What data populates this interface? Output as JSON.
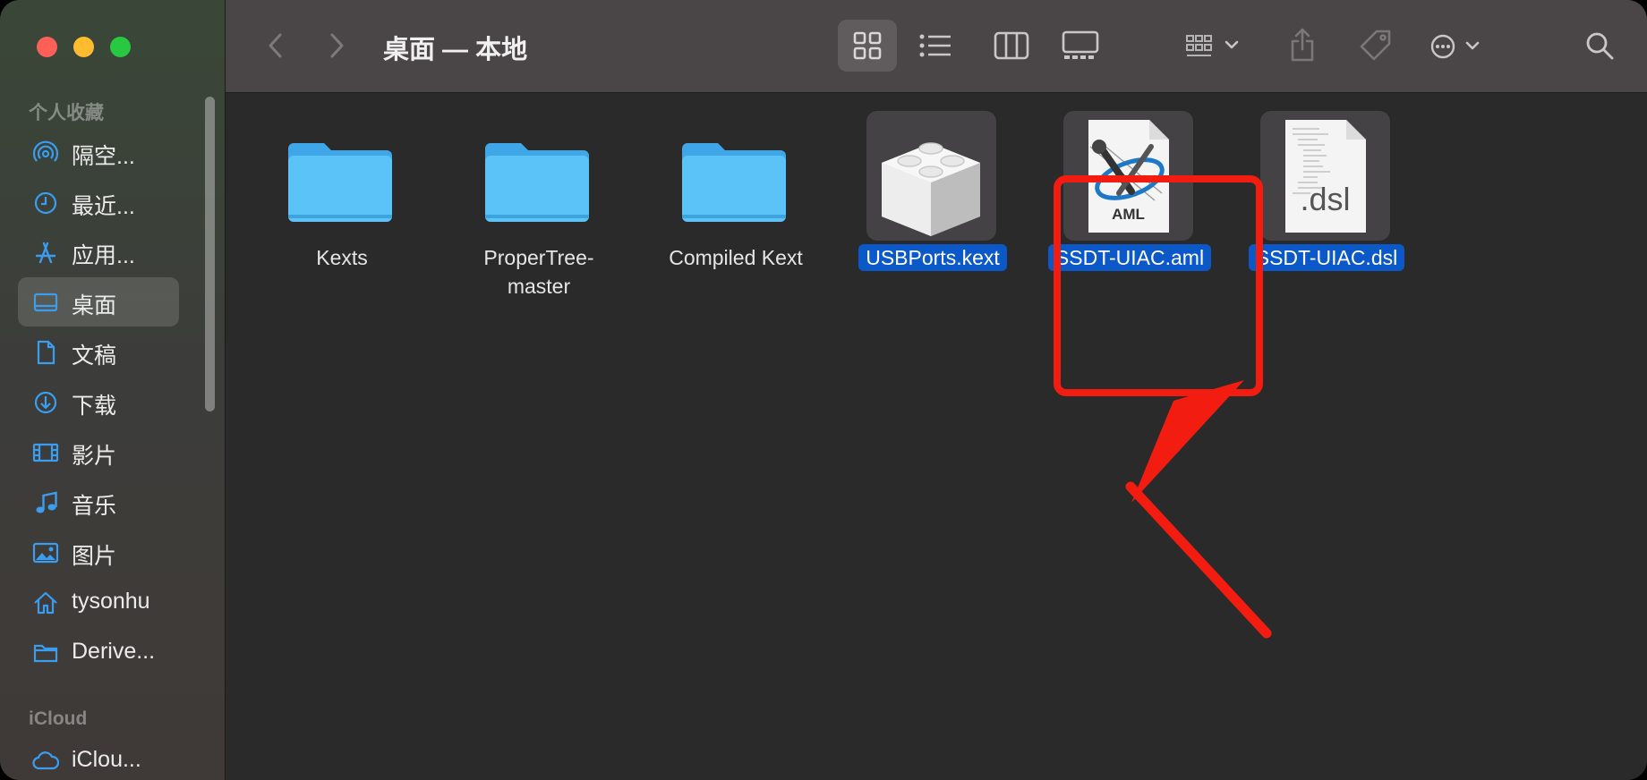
{
  "window": {
    "title": "桌面 — 本地"
  },
  "sidebar": {
    "favorites_title": "个人收藏",
    "items": [
      {
        "label": "隔空...",
        "icon": "airdrop-icon"
      },
      {
        "label": "最近...",
        "icon": "clock-icon"
      },
      {
        "label": "应用...",
        "icon": "applications-icon"
      },
      {
        "label": "桌面",
        "icon": "desktop-icon",
        "active": true
      },
      {
        "label": "文稿",
        "icon": "document-icon"
      },
      {
        "label": "下载",
        "icon": "download-icon"
      },
      {
        "label": "影片",
        "icon": "film-icon"
      },
      {
        "label": "音乐",
        "icon": "music-icon"
      },
      {
        "label": "图片",
        "icon": "photo-icon"
      },
      {
        "label": "tysonhu",
        "icon": "home-icon"
      },
      {
        "label": "Derive...",
        "icon": "folder-icon"
      }
    ],
    "icloud_title": "iCloud",
    "icloud_items": [
      {
        "label": "iClou...",
        "icon": "cloud-icon"
      }
    ]
  },
  "toolbar": {
    "buttons": [
      "back-icon",
      "forward-icon",
      "icon-view-icon",
      "list-view-icon",
      "column-view-icon",
      "gallery-view-icon",
      "group-icon",
      "share-icon",
      "tag-icon",
      "more-icon",
      "search-icon"
    ],
    "selected_view": "icon-view"
  },
  "files": [
    {
      "name": "Kexts",
      "kind": "folder",
      "selected": false
    },
    {
      "name": "ProperTree-master",
      "name_lines": [
        "ProperTree-",
        "master"
      ],
      "kind": "folder",
      "selected": false
    },
    {
      "name": "Compiled Kext",
      "kind": "folder",
      "selected": false
    },
    {
      "name": "USBPorts.kext",
      "kind": "kext",
      "selected": true
    },
    {
      "name": "SSDT-UIAC.aml",
      "kind": "aml",
      "badge": "AML",
      "selected": true
    },
    {
      "name": "SSDT-UIAC.dsl",
      "kind": "dsl",
      "badge": ".dsl",
      "selected": true
    }
  ],
  "colors": {
    "accent_selection": "#0b58c9",
    "folder_blue": "#5bc3f7",
    "annotation_red": "#f21d10"
  }
}
